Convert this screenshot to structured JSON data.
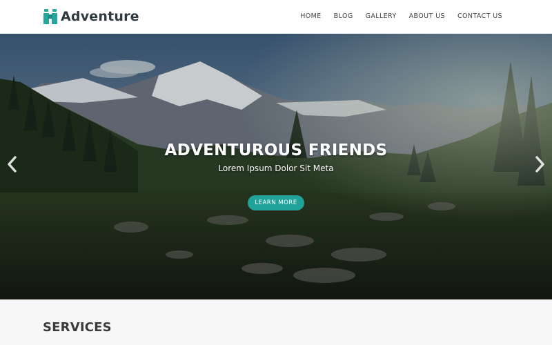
{
  "brand": {
    "name": "Adventure",
    "logo_icon": "binoculars-icon",
    "accent_color": "#21a39a"
  },
  "nav": {
    "items": [
      {
        "label": "HOME"
      },
      {
        "label": "BLOG"
      },
      {
        "label": "GALLERY"
      },
      {
        "label": "ABOUT US"
      },
      {
        "label": "CONTACT US"
      }
    ]
  },
  "hero": {
    "title": "ADVENTUROUS FRIENDS",
    "subtitle": "Lorem Ipsum Dolor Sit Meta",
    "button_label": "LEARN MORE",
    "prev_icon": "chevron-left-icon",
    "next_icon": "chevron-right-icon"
  },
  "services": {
    "heading": "SERVICES"
  }
}
